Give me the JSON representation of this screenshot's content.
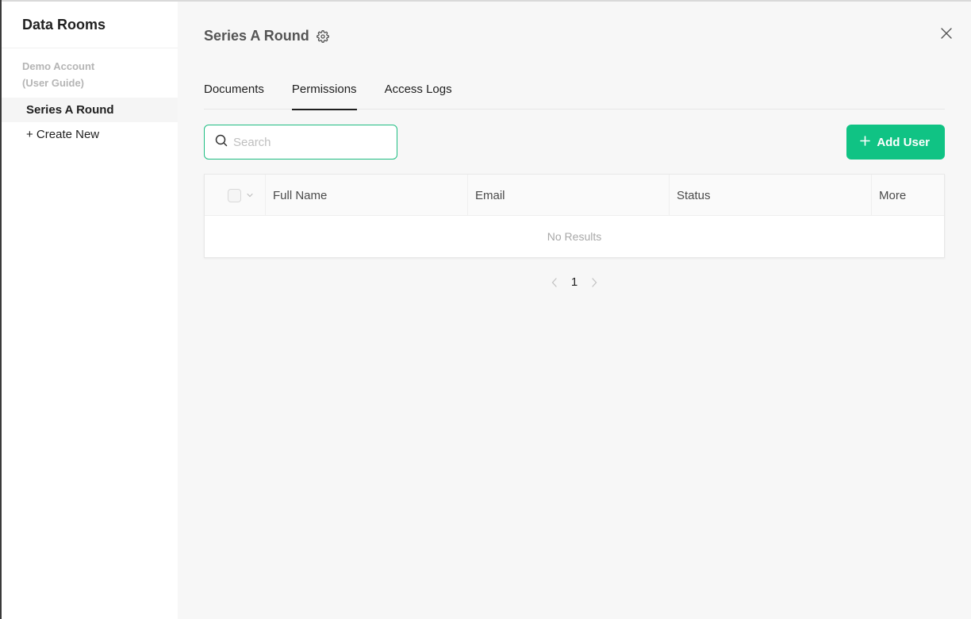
{
  "sidebar": {
    "title": "Data Rooms",
    "group_label": "Demo Account (User Guide)",
    "items": [
      {
        "label": "Series A Round",
        "active": true
      },
      {
        "label": "+ Create New",
        "active": false
      }
    ]
  },
  "header": {
    "title": "Series A Round",
    "settings_icon": "gear-icon",
    "close_icon": "close-icon"
  },
  "tabs": [
    {
      "label": "Documents",
      "active": false
    },
    {
      "label": "Permissions",
      "active": true
    },
    {
      "label": "Access Logs",
      "active": false
    }
  ],
  "search": {
    "placeholder": "Search",
    "value": ""
  },
  "add_user_button": {
    "label": "Add User"
  },
  "table": {
    "columns": [
      "Full Name",
      "Email",
      "Status",
      "More"
    ],
    "empty_text": "No Results"
  },
  "pagination": {
    "current_page": "1"
  },
  "colors": {
    "accent": "#10c384",
    "search_border": "#1fbd82"
  }
}
